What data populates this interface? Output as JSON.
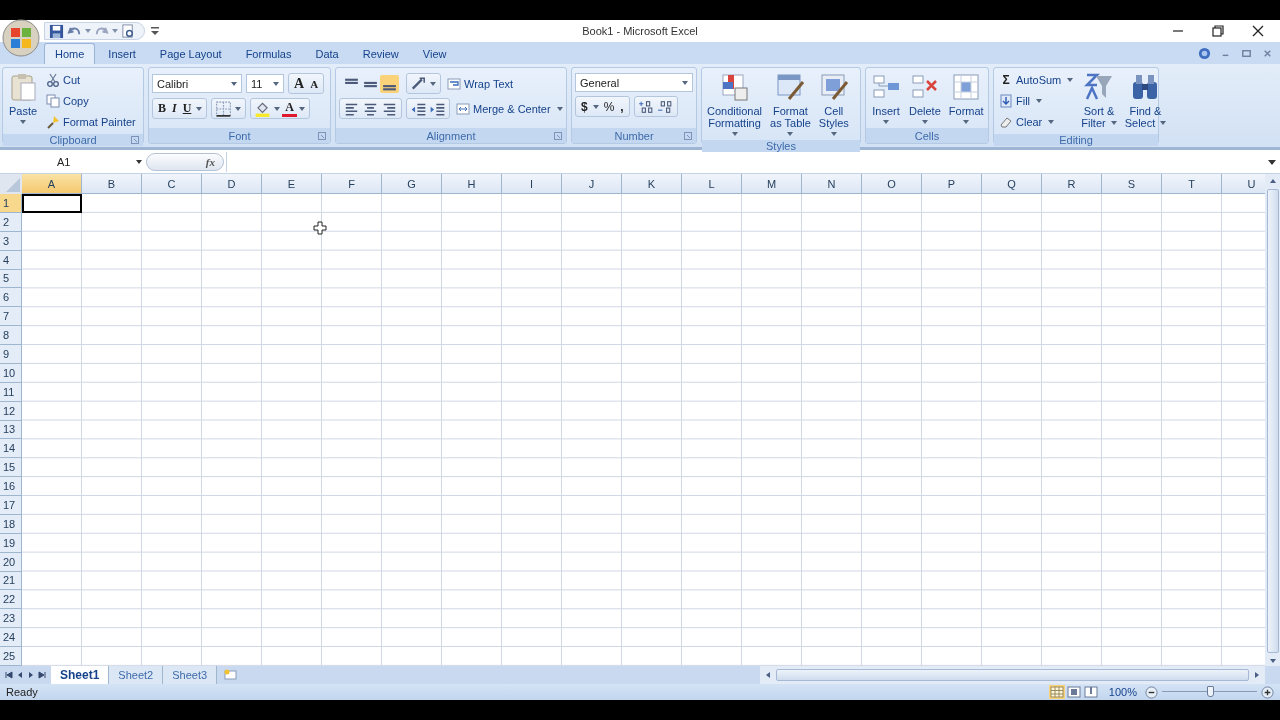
{
  "window": {
    "title": "Book1 - Microsoft Excel"
  },
  "ribbon_tabs": [
    {
      "label": "Home",
      "selected": true
    },
    {
      "label": "Insert",
      "selected": false
    },
    {
      "label": "Page Layout",
      "selected": false
    },
    {
      "label": "Formulas",
      "selected": false
    },
    {
      "label": "Data",
      "selected": false
    },
    {
      "label": "Review",
      "selected": false
    },
    {
      "label": "View",
      "selected": false
    }
  ],
  "clipboard": {
    "label": "Clipboard",
    "paste": "Paste",
    "cut": "Cut",
    "copy": "Copy",
    "format_painter": "Format Painter"
  },
  "font": {
    "label": "Font",
    "font_name": "Calibri",
    "font_size": "11",
    "grow": "A",
    "shrink": "A",
    "bold": "B",
    "italic": "I",
    "underline": "U",
    "font_color": "A"
  },
  "alignment": {
    "label": "Alignment",
    "vertical_align": [
      {
        "selected": false
      },
      {
        "selected": false
      },
      {
        "selected": true
      }
    ],
    "wrap_text": "Wrap Text",
    "merge_center": "Merge & Center"
  },
  "number": {
    "label": "Number",
    "format": "General",
    "currency": "$",
    "percent": "%",
    "comma": ","
  },
  "styles": {
    "label": "Styles",
    "buttons": [
      {
        "kind": "conditional",
        "lines": [
          "Conditional",
          "Formatting"
        ]
      },
      {
        "kind": "table",
        "lines": [
          "Format",
          "as Table"
        ]
      },
      {
        "kind": "cellstyles",
        "lines": [
          "Cell",
          "Styles"
        ]
      }
    ]
  },
  "cells": {
    "label": "Cells",
    "buttons": [
      {
        "kind": "insert",
        "lines": [
          "Insert"
        ]
      },
      {
        "kind": "delete",
        "lines": [
          "Delete"
        ]
      },
      {
        "kind": "format",
        "lines": [
          "Format"
        ]
      }
    ]
  },
  "editing": {
    "label": "Editing",
    "sigma": "Σ",
    "autosum": "AutoSum",
    "fill": "Fill",
    "clear": "Clear",
    "buttons": [
      {
        "kind": "sort",
        "lines": [
          "Sort &",
          "Filter"
        ]
      },
      {
        "kind": "find",
        "lines": [
          "Find &",
          "Select"
        ]
      }
    ]
  },
  "formula_bar": {
    "name_box": "A1",
    "fx": "fx"
  },
  "sheet": {
    "columns": [
      {
        "label": "A",
        "selected": true
      },
      {
        "label": "B",
        "selected": false
      },
      {
        "label": "C",
        "selected": false
      },
      {
        "label": "D",
        "selected": false
      },
      {
        "label": "E",
        "selected": false
      },
      {
        "label": "F",
        "selected": false
      },
      {
        "label": "G",
        "selected": false
      },
      {
        "label": "H",
        "selected": false
      },
      {
        "label": "I",
        "selected": false
      },
      {
        "label": "J",
        "selected": false
      },
      {
        "label": "K",
        "selected": false
      },
      {
        "label": "L",
        "selected": false
      },
      {
        "label": "M",
        "selected": false
      },
      {
        "label": "N",
        "selected": false
      },
      {
        "label": "O",
        "selected": false
      },
      {
        "label": "P",
        "selected": false
      },
      {
        "label": "Q",
        "selected": false
      },
      {
        "label": "R",
        "selected": false
      },
      {
        "label": "S",
        "selected": false
      },
      {
        "label": "T",
        "selected": false
      },
      {
        "label": "U",
        "selected": false
      }
    ],
    "rows": [
      {
        "label": "1",
        "selected": true
      },
      {
        "label": "2",
        "selected": false
      },
      {
        "label": "3",
        "selected": false
      },
      {
        "label": "4",
        "selected": false
      },
      {
        "label": "5",
        "selected": false
      },
      {
        "label": "6",
        "selected": false
      },
      {
        "label": "7",
        "selected": false
      },
      {
        "label": "8",
        "selected": false
      },
      {
        "label": "9",
        "selected": false
      },
      {
        "label": "10",
        "selected": false
      },
      {
        "label": "11",
        "selected": false
      },
      {
        "label": "12",
        "selected": false
      },
      {
        "label": "13",
        "selected": false
      },
      {
        "label": "14",
        "selected": false
      },
      {
        "label": "15",
        "selected": false
      },
      {
        "label": "16",
        "selected": false
      },
      {
        "label": "17",
        "selected": false
      },
      {
        "label": "18",
        "selected": false
      },
      {
        "label": "19",
        "selected": false
      },
      {
        "label": "20",
        "selected": false
      },
      {
        "label": "21",
        "selected": false
      },
      {
        "label": "22",
        "selected": false
      },
      {
        "label": "23",
        "selected": false
      },
      {
        "label": "24",
        "selected": false
      },
      {
        "label": "25",
        "selected": false
      }
    ]
  },
  "sheet_tabs": [
    {
      "label": "Sheet1",
      "selected": true
    },
    {
      "label": "Sheet2",
      "selected": false
    },
    {
      "label": "Sheet3",
      "selected": false
    }
  ],
  "status_bar": {
    "status": "Ready",
    "views": [
      {
        "kind": "normal",
        "selected": true
      },
      {
        "kind": "page_layout",
        "selected": false
      },
      {
        "kind": "page_break",
        "selected": false
      }
    ],
    "zoom": "100%",
    "zoom_slider": {
      "level": 0.5
    }
  }
}
